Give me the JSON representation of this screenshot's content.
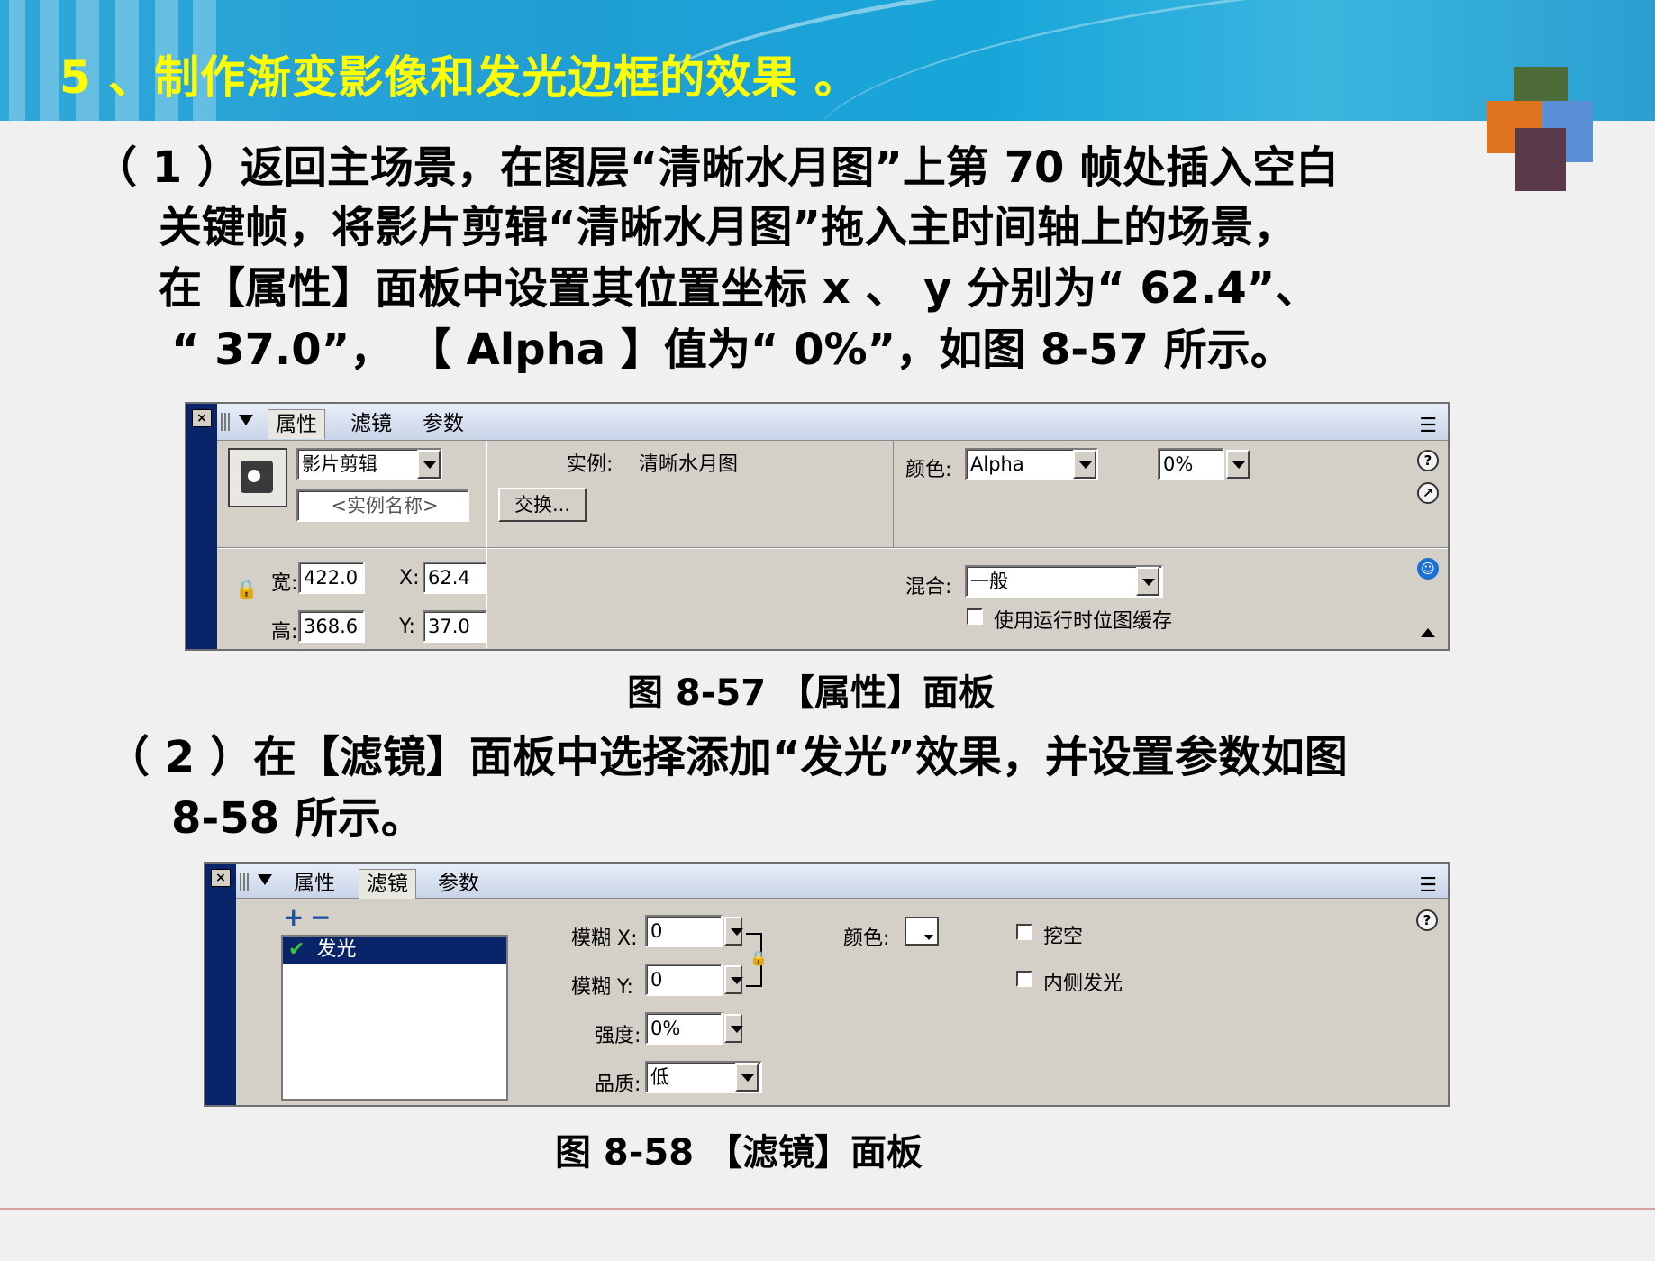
{
  "header": {
    "title": "5 、制作渐变影像和发光边框的效果 。"
  },
  "step1": {
    "line1": "（ 1 ）返回主场景，在图层“清晰水月图”上第 70 帧处插入空白",
    "line2": "关键帧，将影片剪辑“清晰水月图”拖入主时间轴上的场景，",
    "line3": "在【属性】面板中设置其位置坐标 x 、 y 分别为“ 62.4”、",
    "line4": "“ 37.0”， 【 Alpha 】值为“ 0%”，如图 8-57 所示。"
  },
  "panel1": {
    "tabs": [
      "属性",
      "滤镜",
      "参数"
    ],
    "symbol_type": "影片剪辑",
    "instance_name_placeholder": "<实例名称>",
    "instance_label": "实例:",
    "instance_value": "清晰水月图",
    "swap_button": "交换...",
    "color_label": "颜色:",
    "color_mode": "Alpha",
    "alpha_value": "0%",
    "width_label": "宽:",
    "width_value": "422.0",
    "height_label": "高:",
    "height_value": "368.6",
    "x_label": "X:",
    "x_value": "62.4",
    "y_label": "Y:",
    "y_value": "37.0",
    "blend_label": "混合:",
    "blend_value": "一般",
    "cache_label": "使用运行时位图缓存"
  },
  "caption1": "图 8-57 【属性】面板",
  "step2": {
    "line1": "（ 2 ）在【滤镜】面板中选择添加“发光”效果，并设置参数如图",
    "line2": "8-58 所示。"
  },
  "panel2": {
    "tabs": [
      "属性",
      "滤镜",
      "参数"
    ],
    "filter_items": [
      "发光"
    ],
    "blur_x_label": "模糊 X:",
    "blur_x_value": "0",
    "blur_y_label": "模糊 Y:",
    "blur_y_value": "0",
    "strength_label": "强度:",
    "strength_value": "0%",
    "quality_label": "品质:",
    "quality_value": "低",
    "color_label": "颜色:",
    "knockout_label": "挖空",
    "inner_glow_label": "内侧发光"
  },
  "caption2": "图 8-58 【滤镜】面板",
  "colors": {
    "banner": "#1f9ed4",
    "title_text": "#ffff00",
    "panel_bg": "#d4d0c8",
    "panel_side": "#0a246a"
  }
}
